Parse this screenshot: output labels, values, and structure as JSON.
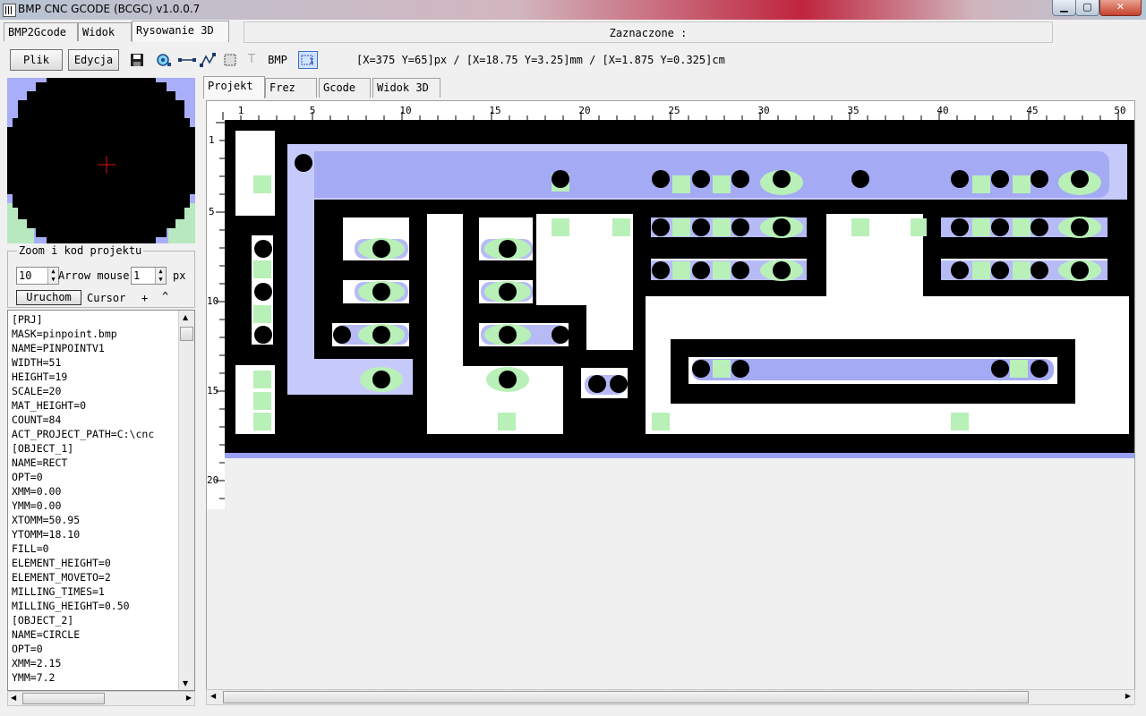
{
  "window": {
    "title": "BMP CNC GCODE (BCGC) v1.0.0.7"
  },
  "main_tabs": [
    "BMP2Gcode",
    "Widok",
    "Rysowanie 3D"
  ],
  "selection_label": "Zaznaczone :",
  "toolbar": {
    "plik": "Plik",
    "edycja": "Edycja",
    "text_tool": "T",
    "bmp_label": "BMP",
    "coords": "[X=375 Y=65]px / [X=18.75 Y=3.25]mm / [X=1.875 Y=0.325]cm"
  },
  "zoom_panel": {
    "legend": "Zoom i kod projektu",
    "zoom_value": "10",
    "arrow_label": "Arrow mouse",
    "arrow_value": "1",
    "unit": "px",
    "run_button": "Uruchom",
    "cursor_label": "Cursor",
    "plus": "+",
    "caret": "^"
  },
  "code_lines": [
    "[PRJ]",
    "MASK=pinpoint.bmp",
    "NAME=PINPOINTV1",
    "WIDTH=51",
    "HEIGHT=19",
    "SCALE=20",
    "MAT_HEIGHT=0",
    "COUNT=84",
    "ACT_PROJECT_PATH=C:\\cnc",
    "[OBJECT_1]",
    "NAME=RECT",
    "OPT=0",
    "XMM=0.00",
    "YMM=0.00",
    "XTOMM=50.95",
    "YTOMM=18.10",
    "FILL=0",
    "ELEMENT_HEIGHT=0",
    "ELEMENT_MOVETO=2",
    "MILLING_TIMES=1",
    "MILLING_HEIGHT=0.50",
    "[OBJECT_2]",
    "NAME=CIRCLE",
    "OPT=0",
    "XMM=2.15",
    "YMM=7.2"
  ],
  "inner_tabs": [
    "Projekt",
    "Frez",
    "Gcode",
    "Widok 3D"
  ],
  "ruler": {
    "x_labels": [
      "1",
      "5",
      "10",
      "15",
      "20",
      "25",
      "30",
      "35",
      "40",
      "45",
      "50"
    ],
    "y_labels": [
      "1",
      "5",
      "10",
      "15",
      "20"
    ]
  },
  "colors": {
    "accent_blue": "#a9aefa",
    "pad_green": "#b8f0b8",
    "copper_black": "#000000",
    "cursor_red": "#e01010"
  }
}
